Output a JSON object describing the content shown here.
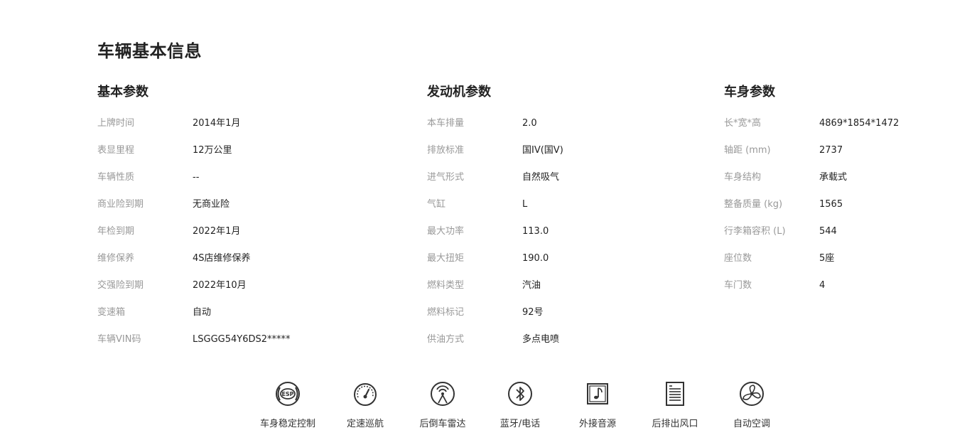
{
  "page": {
    "title": "车辆基本信息"
  },
  "basic": {
    "title": "基本参数",
    "rows": [
      {
        "label": "上牌时间",
        "value": "2014年1月"
      },
      {
        "label": "表显里程",
        "value": "12万公里"
      },
      {
        "label": "车辆性质",
        "value": "--"
      },
      {
        "label": "商业险到期",
        "value": "无商业险"
      },
      {
        "label": "年检到期",
        "value": "2022年1月"
      },
      {
        "label": "维修保养",
        "value": "4S店维修保养"
      },
      {
        "label": "交强险到期",
        "value": "2022年10月"
      },
      {
        "label": "变速箱",
        "value": "自动"
      },
      {
        "label": "车辆VIN码",
        "value": "LSGGG54Y6DS2*****"
      }
    ]
  },
  "engine": {
    "title": "发动机参数",
    "rows": [
      {
        "label": "本车排量",
        "value": "2.0"
      },
      {
        "label": "排放标准",
        "value": "国IV(国V)"
      },
      {
        "label": "进气形式",
        "value": "自然吸气"
      },
      {
        "label": "气缸",
        "value": "L"
      },
      {
        "label": "最大功率",
        "value": "113.0"
      },
      {
        "label": "最大扭矩",
        "value": "190.0"
      },
      {
        "label": "燃料类型",
        "value": "汽油"
      },
      {
        "label": "燃料标记",
        "value": "92号"
      },
      {
        "label": "供油方式",
        "value": "多点电喷"
      }
    ]
  },
  "body": {
    "title": "车身参数",
    "rows": [
      {
        "label": "长*宽*高",
        "value": "4869*1854*1472"
      },
      {
        "label": "轴距 (mm)",
        "value": "2737"
      },
      {
        "label": "车身结构",
        "value": "承载式"
      },
      {
        "label": "整备质量 (kg)",
        "value": "1565"
      },
      {
        "label": "行李箱容积 (L)",
        "value": "544"
      },
      {
        "label": "座位数",
        "value": "5座"
      },
      {
        "label": "车门数",
        "value": "4"
      }
    ]
  },
  "features": [
    {
      "label": "车身稳定控制",
      "icon": "esp-icon",
      "icon_text": "ESP"
    },
    {
      "label": "定速巡航",
      "icon": "cruise-control-icon"
    },
    {
      "label": "后倒车雷达",
      "icon": "parking-radar-icon"
    },
    {
      "label": "蓝牙/电话",
      "icon": "bluetooth-icon"
    },
    {
      "label": "外接音源",
      "icon": "music-input-icon"
    },
    {
      "label": "后排出风口",
      "icon": "rear-air-vent-icon"
    },
    {
      "label": "自动空调",
      "icon": "auto-ac-fan-icon"
    }
  ]
}
